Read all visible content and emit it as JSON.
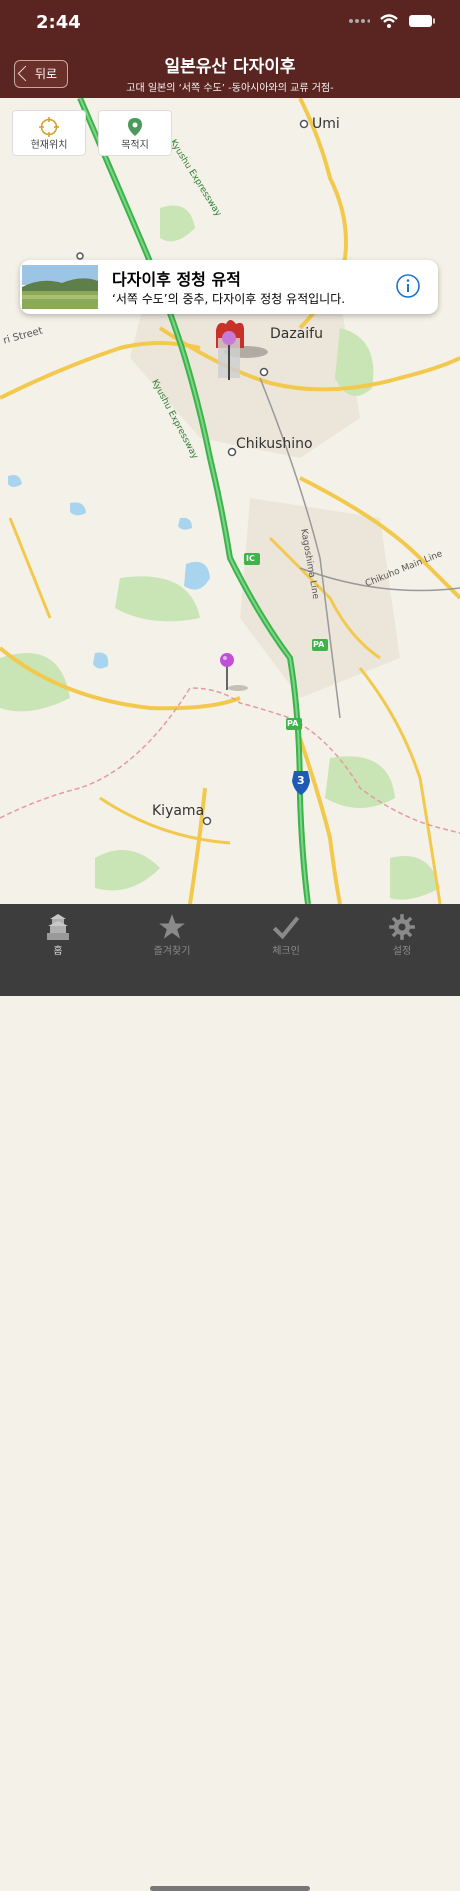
{
  "status": {
    "time": "2:44"
  },
  "nav": {
    "back_label": "뒤로",
    "title": "일본유산 다자이후",
    "subtitle": "고대 일본의 ‘서쪽 수도’ -동아시아와의 교류 거점-"
  },
  "map_buttons": {
    "current_location": "현재위치",
    "destination": "목적지"
  },
  "callout": {
    "title": "다자이후 정청 유적",
    "subtitle": "‘서쪽 수도’의 중추, 다자이후 정청 유적입니다."
  },
  "map_labels": {
    "umi": "Umi",
    "dazaifu": "Dazaifu",
    "chikushino": "Chikushino",
    "kiyama": "Kiyama",
    "kyushu_exp1": "Kyushu Expressway",
    "kyushu_exp2": "Kyushu Expressway",
    "kagoshima": "Kagoshima Line",
    "chikuho": "Chikuho Main Line",
    "street": "Street",
    "street_partial": "ri Street",
    "ic": "IC",
    "pa1": "PA",
    "pa2": "PA",
    "route3": "3"
  },
  "tabs": [
    {
      "label": "홈",
      "icon": "castle-icon"
    },
    {
      "label": "즐겨찾기",
      "icon": "star-icon"
    },
    {
      "label": "체크인",
      "icon": "checkmark-icon"
    },
    {
      "label": "설정",
      "icon": "gear-icon"
    }
  ],
  "colors": {
    "header": "#5a2420",
    "tabbar": "#3d3d3d",
    "expressway": "#3bb54a",
    "road": "#f2c94c"
  }
}
